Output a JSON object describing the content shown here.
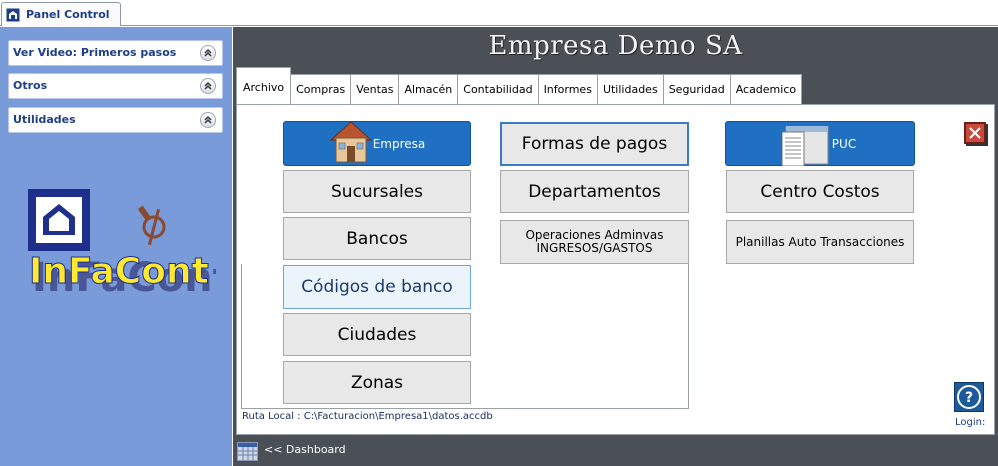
{
  "doc_tab": {
    "label": "Panel Control"
  },
  "sidebar": {
    "items": [
      {
        "label": "Ver Video: Primeros pasos"
      },
      {
        "label": "Otros"
      },
      {
        "label": "Utilidades"
      }
    ]
  },
  "logo": {
    "text": "InFaCont"
  },
  "header": {
    "company": "Empresa Demo SA"
  },
  "tabs": [
    "Archivo",
    "Compras",
    "Ventas",
    "Almacén",
    "Contabilidad",
    "Informes",
    "Utilidades",
    "Seguridad",
    "Academico"
  ],
  "buttons": {
    "empresa": "Empresa",
    "sucursales": "Sucursales",
    "bancos": "Bancos",
    "codigos_banco": "Códigos de banco",
    "ciudades": "Ciudades",
    "zonas": "Zonas",
    "formas_pagos": "Formas de pagos",
    "departamentos": "Departamentos",
    "operaciones": "Operaciones Adminvas INGRESOS/GASTOS",
    "puc": "PUC",
    "centro_costos": "Centro Costos",
    "planillas": "Planillas Auto Transacciones"
  },
  "status": {
    "ruta": "Ruta Local : C:\\Facturacion\\Empresa1\\datos.accdb"
  },
  "login": {
    "label": "Login:"
  },
  "footer": {
    "dashboard": "<< Dashboard"
  },
  "colors": {
    "sidebar_bg": "#7a9bd9",
    "main_bg": "#4a5056",
    "accent_blue": "#1f6fc3",
    "logo_yellow": "#ffe930"
  }
}
